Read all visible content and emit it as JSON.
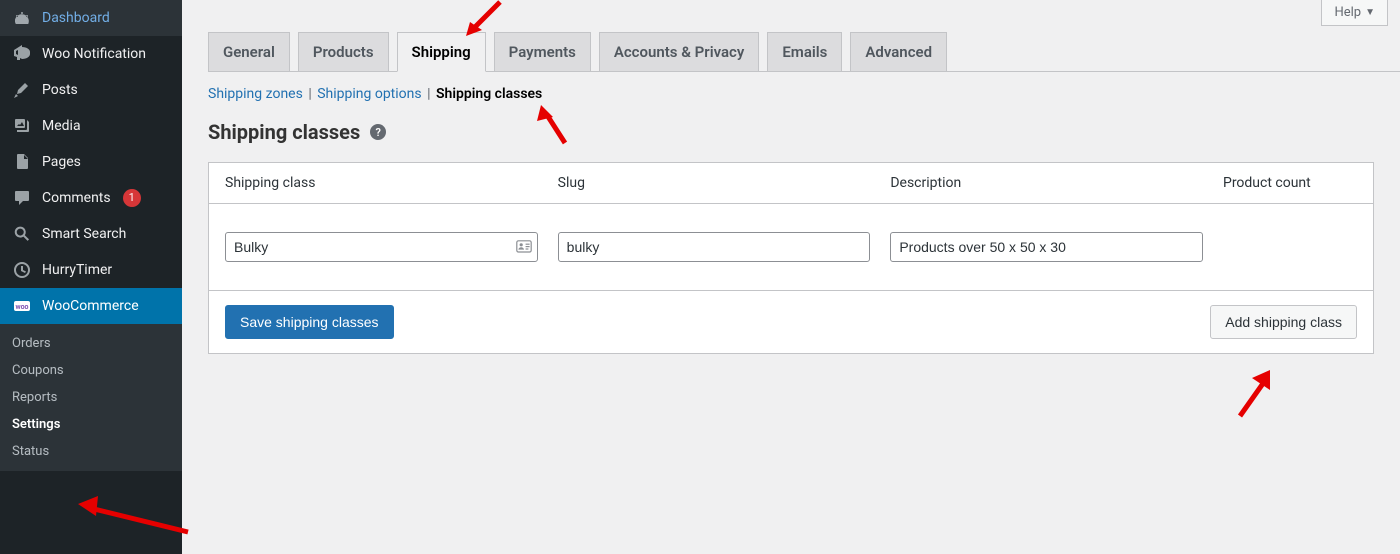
{
  "sidebar": {
    "items": [
      {
        "label": "Dashboard",
        "icon": "dashboard"
      },
      {
        "label": "Woo Notification",
        "icon": "megaphone"
      },
      {
        "label": "Posts",
        "icon": "pushpin"
      },
      {
        "label": "Media",
        "icon": "media"
      },
      {
        "label": "Pages",
        "icon": "page"
      },
      {
        "label": "Comments",
        "icon": "comment",
        "badge": "1"
      },
      {
        "label": "Smart Search",
        "icon": "search"
      },
      {
        "label": "HurryTimer",
        "icon": "timer"
      },
      {
        "label": "WooCommerce",
        "icon": "woo",
        "active": true
      }
    ],
    "submenu": [
      {
        "label": "Orders"
      },
      {
        "label": "Coupons"
      },
      {
        "label": "Reports"
      },
      {
        "label": "Settings",
        "current": true
      },
      {
        "label": "Status"
      }
    ]
  },
  "top": {
    "help": "Help"
  },
  "tabs": [
    {
      "label": "General"
    },
    {
      "label": "Products"
    },
    {
      "label": "Shipping",
      "active": true
    },
    {
      "label": "Payments"
    },
    {
      "label": "Accounts & Privacy"
    },
    {
      "label": "Emails"
    },
    {
      "label": "Advanced"
    }
  ],
  "subtabs": {
    "zones": "Shipping zones",
    "options": "Shipping options",
    "classes": "Shipping classes"
  },
  "page_title": "Shipping classes",
  "table": {
    "headers": {
      "class": "Shipping class",
      "slug": "Slug",
      "description": "Description",
      "count": "Product count"
    },
    "row": {
      "class": "Bulky",
      "slug": "bulky",
      "description": "Products over 50 x 50 x 30",
      "count": ""
    }
  },
  "buttons": {
    "save": "Save shipping classes",
    "add": "Add shipping class"
  }
}
